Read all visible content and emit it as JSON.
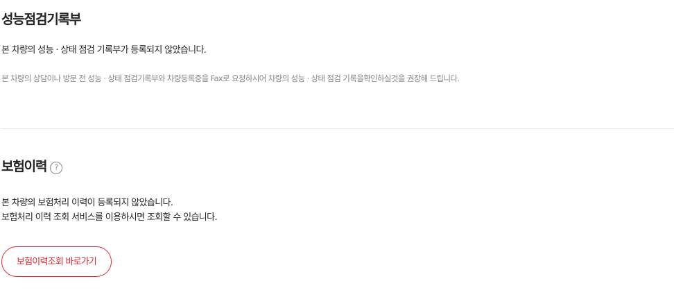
{
  "performance": {
    "title": "성능점검기록부",
    "message": "본 차량의 성능 · 상태 점검 기록부가 등록되지 않았습니다.",
    "note": "본 차량의 상담이나 방문 전 성능 · 상태 점검기록부와 차량등록증을 Fax로 요청하시어 차량의 성능 · 상태 점검 기록을확인하실것을 권장해 드립니다."
  },
  "insurance": {
    "title": "보험이력",
    "help_icon": "?",
    "message_line1": "본 차량의 보험처리 이력이 등록되지 않았습니다.",
    "message_line2": "보험처리 이력 조회 서비스를 이용하시면 조회할 수 있습니다.",
    "button_label": "보험이력조회 바로가기"
  },
  "colors": {
    "accent": "#e8262d",
    "text": "#222222",
    "muted": "#888888",
    "divider": "#e6e6e6"
  }
}
